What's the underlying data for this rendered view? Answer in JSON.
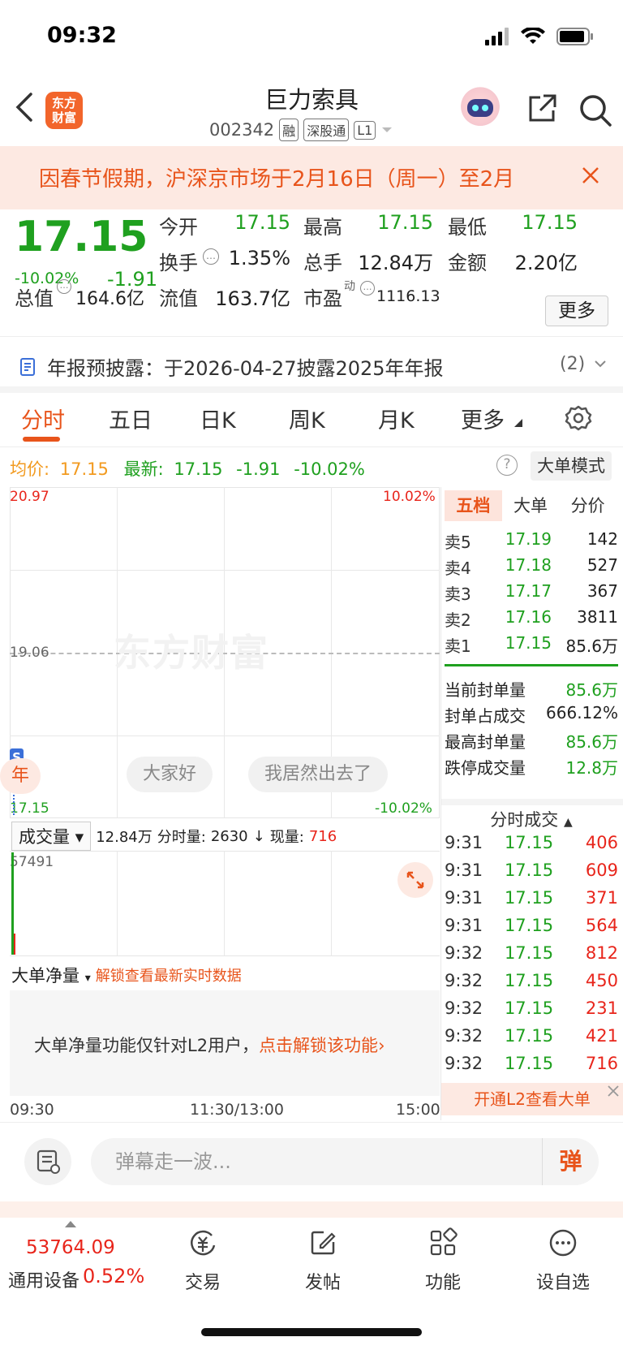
{
  "status_bar": {
    "time": "09:32"
  },
  "header": {
    "stock_name": "巨力索具",
    "stock_code": "002342",
    "tags": [
      "融",
      "深股通",
      "L1"
    ],
    "logo_text": "东方财富"
  },
  "banner": {
    "text": "因春节假期，沪深京市场于2月16日（周一）至2月"
  },
  "quote": {
    "price": "17.15",
    "change_pct": "-10.02%",
    "change": "-1.91",
    "fields": [
      {
        "label": "今开",
        "value": "17.15"
      },
      {
        "label": "最高",
        "value": "17.15"
      },
      {
        "label": "最低",
        "value": "17.15"
      },
      {
        "label": "换手",
        "value": "1.35%"
      },
      {
        "label": "总手",
        "value": "12.84万"
      },
      {
        "label": "金额",
        "value": "2.20亿"
      },
      {
        "label": "总值",
        "value": "164.6亿"
      },
      {
        "label": "流值",
        "value": "163.7亿"
      },
      {
        "label": "市盈",
        "value": "1116.13",
        "sup": "动"
      }
    ],
    "more_label": "更多"
  },
  "notice": {
    "text": "年报预披露：于2026-04-27披露2025年年报",
    "count": "(2)"
  },
  "tabs": [
    "分时",
    "五日",
    "日K",
    "周K",
    "月K",
    "更多"
  ],
  "summary": {
    "avg_label": "均价:",
    "avg_value": "17.15",
    "latest_label": "最新:",
    "latest_value": "17.15",
    "latest_change": "-1.91",
    "latest_pct": "-10.02%",
    "mode_button": "大单模式"
  },
  "chart": {
    "y_top": "20.97",
    "y_mid": "19.06",
    "y_bottom": "17.15",
    "pct_top": "10.02%",
    "pct_bottom": "-10.02%",
    "watermark": "东方财富",
    "danmu": [
      "年",
      "大家好",
      "我居然出去了"
    ],
    "marker": "S"
  },
  "volume": {
    "selector": "成交量",
    "total": "12.84万",
    "fs_label": "分时量:",
    "fs_value": "2630",
    "now_label": "现量:",
    "now_value": "716",
    "max": "57491"
  },
  "net": {
    "selector": "大单净量",
    "unlock_text": "解锁查看最新实时数据",
    "message": "大单净量功能仅针对L2用户，",
    "message_link": "点击解锁该功能"
  },
  "time_axis": [
    "09:30",
    "11:30/13:00",
    "15:00"
  ],
  "order_book": {
    "tabs": [
      "五档",
      "大单",
      "分价"
    ],
    "asks": [
      {
        "level": "卖5",
        "price": "17.19",
        "vol": "142"
      },
      {
        "level": "卖4",
        "price": "17.18",
        "vol": "527"
      },
      {
        "level": "卖3",
        "price": "17.17",
        "vol": "367"
      },
      {
        "level": "卖2",
        "price": "17.16",
        "vol": "3811"
      },
      {
        "level": "卖1",
        "price": "17.15",
        "vol": "85.6万"
      }
    ],
    "seal": [
      {
        "label": "当前封单量",
        "value": "85.6万"
      },
      {
        "label": "封单占成交",
        "value": "666.12%"
      },
      {
        "label": "最高封单量",
        "value": "85.6万"
      },
      {
        "label": "跌停成交量",
        "value": "12.8万"
      }
    ],
    "ticks_title": "分时成交",
    "ticks": [
      {
        "time": "9:31",
        "price": "17.15",
        "vol": "406"
      },
      {
        "time": "9:31",
        "price": "17.15",
        "vol": "609"
      },
      {
        "time": "9:31",
        "price": "17.15",
        "vol": "371"
      },
      {
        "time": "9:31",
        "price": "17.15",
        "vol": "564"
      },
      {
        "time": "9:32",
        "price": "17.15",
        "vol": "812"
      },
      {
        "time": "9:32",
        "price": "17.15",
        "vol": "450"
      },
      {
        "time": "9:32",
        "price": "17.15",
        "vol": "231"
      },
      {
        "time": "9:32",
        "price": "17.15",
        "vol": "421"
      },
      {
        "time": "9:32",
        "price": "17.15",
        "vol": "716"
      }
    ],
    "l2_banner": "开通L2查看大单"
  },
  "comment": {
    "placeholder": "弹幕走一波...",
    "button": "弹"
  },
  "bottom_nav": {
    "index_value": "53764.09",
    "index_name": "通用设备",
    "index_pct": "0.52%",
    "items": [
      "交易",
      "发帖",
      "功能",
      "设自选"
    ]
  },
  "colors": {
    "accent": "#e8541b",
    "down": "#1fa01f",
    "up": "#e8251b"
  }
}
